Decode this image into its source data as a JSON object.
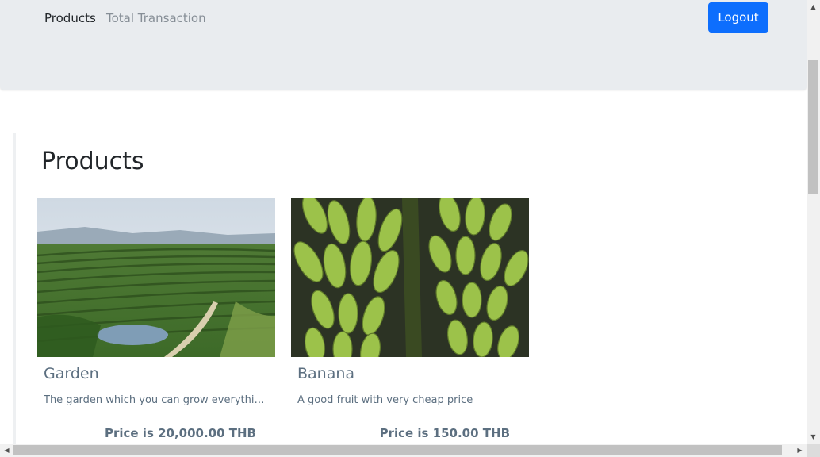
{
  "navbar": {
    "links": [
      "Products",
      "Total Transaction"
    ],
    "logout_label": "Logout",
    "background": "#e9ecef",
    "button_color": "#0d6efd"
  },
  "main": {
    "title": "Products",
    "products": [
      {
        "name": "Garden",
        "description": "The garden which you can grow everything ...",
        "price": "Price is 20,000.00 THB",
        "image": "garden-landscape-image"
      },
      {
        "name": "Banana",
        "description": "A good fruit with very cheap price",
        "price": "Price is 150.00 THB",
        "image": "banana-bunches-image"
      }
    ]
  },
  "scrollbars": {
    "vertical_up": "▲",
    "vertical_down": "▼",
    "horizontal_left": "◀",
    "horizontal_right": "▶"
  }
}
